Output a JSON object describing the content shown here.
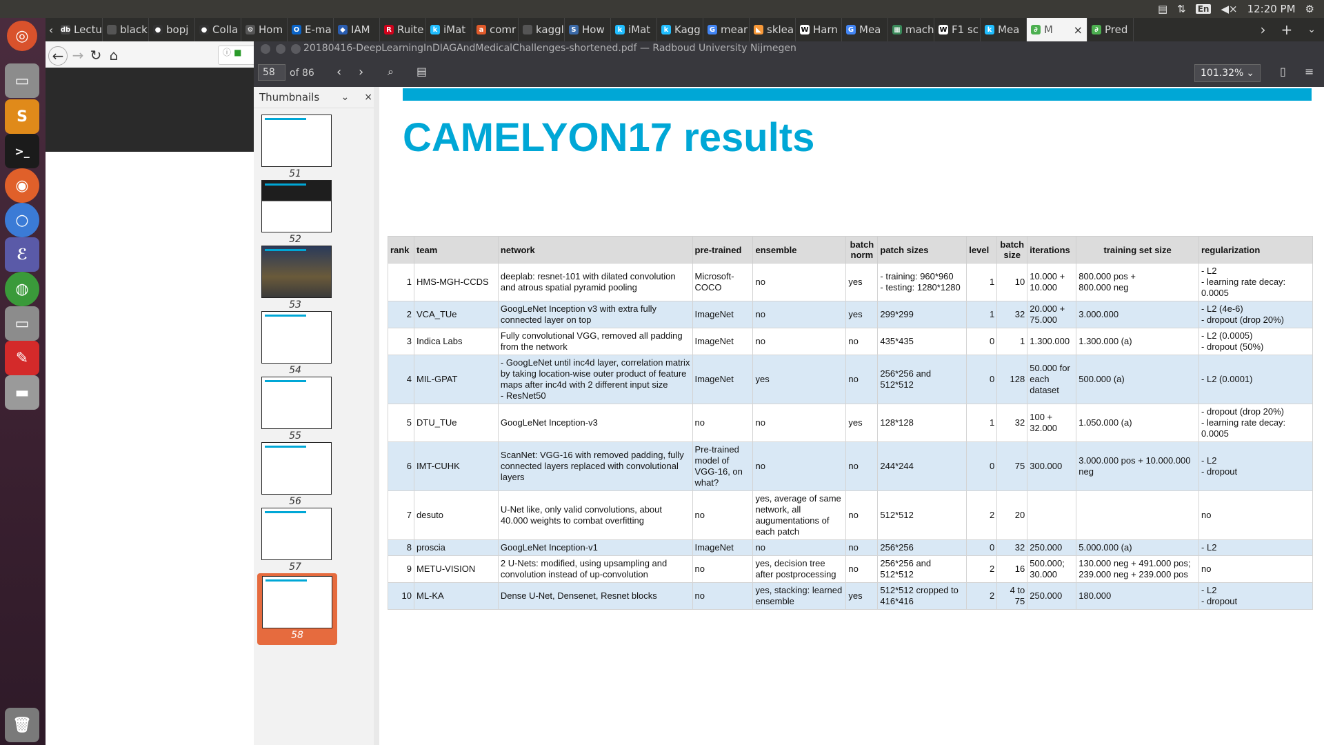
{
  "system": {
    "language": "En",
    "time": "12:20 PM"
  },
  "browser": {
    "tabs": [
      {
        "label": "Lectu",
        "icon": "dblp-icon",
        "color": "#444444",
        "glyph": "db"
      },
      {
        "label": "blackbo",
        "icon": "page-icon",
        "color": "#555555",
        "glyph": ""
      },
      {
        "label": "bopj",
        "icon": "github-icon",
        "color": "#333333",
        "glyph": "●"
      },
      {
        "label": "Colla",
        "icon": "github-icon",
        "color": "#333333",
        "glyph": "●"
      },
      {
        "label": "Hom",
        "icon": "gear-icon",
        "color": "#555555",
        "glyph": "⚙"
      },
      {
        "label": "E-ma",
        "icon": "outlook-icon",
        "color": "#0a64c8",
        "glyph": "O"
      },
      {
        "label": "IAM",
        "icon": "shield-icon",
        "color": "#2a5db0",
        "glyph": "◆"
      },
      {
        "label": "Ruite",
        "icon": "radboud-icon",
        "color": "#d0021b",
        "glyph": "R"
      },
      {
        "label": "iMat",
        "icon": "kaggle-icon",
        "color": "#20beff",
        "glyph": "k"
      },
      {
        "label": "comr",
        "icon": "ask-icon",
        "color": "#e05a2a",
        "glyph": "a"
      },
      {
        "label": "kaggle.c",
        "icon": "page-icon",
        "color": "#555555",
        "glyph": ""
      },
      {
        "label": "How",
        "icon": "stackexchange-icon",
        "color": "#3b6aa8",
        "glyph": "S"
      },
      {
        "label": "iMat",
        "icon": "kaggle-icon",
        "color": "#20beff",
        "glyph": "k"
      },
      {
        "label": "Kagg",
        "icon": "kaggle-icon",
        "color": "#20beff",
        "glyph": "k"
      },
      {
        "label": "mear",
        "icon": "google-icon",
        "color": "#4285f4",
        "glyph": "G"
      },
      {
        "label": "sklea",
        "icon": "sklearn-icon",
        "color": "#f89939",
        "glyph": "◣"
      },
      {
        "label": "Harn",
        "icon": "wikipedia-icon",
        "color": "#ffffff",
        "glyph": "W"
      },
      {
        "label": "Mea",
        "icon": "google-icon",
        "color": "#4285f4",
        "glyph": "G"
      },
      {
        "label": "mach",
        "icon": "chart-icon",
        "color": "#3a8a5a",
        "glyph": "▦"
      },
      {
        "label": "F1 sc",
        "icon": "wikipedia-icon",
        "color": "#ffffff",
        "glyph": "W"
      },
      {
        "label": "Mea",
        "icon": "kaggle-icon",
        "color": "#20beff",
        "glyph": "k"
      },
      {
        "label": "M",
        "icon": "pdf-viewer-icon",
        "color": "#4caf50",
        "glyph": "∂",
        "active": true
      },
      {
        "label": "Pred",
        "icon": "pdf-viewer-icon",
        "color": "#4caf50",
        "glyph": "∂"
      }
    ]
  },
  "pdf": {
    "window_title": "20180416-DeepLearningInDIAGAndMedicalChallenges-shortened.pdf — Radboud University Nijmegen",
    "page_number": "58",
    "page_count": "of 86",
    "zoom": "101.32%",
    "sidebar_title": "Thumbnails",
    "thumbnails": [
      "51",
      "52",
      "53",
      "54",
      "55",
      "56",
      "57",
      "58"
    ],
    "slide_title": "CAMELYON17 results"
  },
  "table": {
    "headers": [
      "rank",
      "team",
      "network",
      "pre-trained",
      "ensemble",
      "batch norm",
      "patch sizes",
      "level",
      "batch size",
      "iterations",
      "training set size",
      "regularization"
    ],
    "rows": [
      [
        "1",
        "HMS-MGH-CCDS",
        "deeplab: resnet-101 with dilated convolution and atrous spatial pyramid pooling",
        "Microsoft-COCO",
        "no",
        "yes",
        "- training: 960*960\n- testing: 1280*1280",
        "1",
        "10",
        "10.000 + 10.000",
        "800.000 pos +\n800.000 neg",
        "- L2\n- learning rate decay: 0.0005"
      ],
      [
        "2",
        "VCA_TUe",
        "GoogLeNet Inception v3 with extra fully connected layer on top",
        "ImageNet",
        "no",
        "yes",
        "299*299",
        "1",
        "32",
        "20.000 + 75.000",
        "3.000.000",
        "- L2 (4e-6)\n- dropout (drop 20%)"
      ],
      [
        "3",
        "Indica Labs",
        "Fully convolutional VGG, removed all padding from the network",
        "ImageNet",
        "no",
        "no",
        "435*435",
        "0",
        "1",
        "1.300.000",
        "1.300.000 (a)",
        "- L2 (0.0005)\n- dropout (50%)"
      ],
      [
        "4",
        "MIL-GPAT",
        "- GoogLeNet until inc4d layer, correlation matrix by taking location-wise outer product of feature maps after inc4d with 2 different input size\n- ResNet50",
        "ImageNet",
        "yes",
        "no",
        "256*256 and 512*512",
        "0",
        "128",
        "50.000 for each dataset",
        "500.000 (a)",
        "- L2 (0.0001)"
      ],
      [
        "5",
        "DTU_TUe",
        "GoogLeNet Inception-v3",
        "no",
        "no",
        "yes",
        "128*128",
        "1",
        "32",
        "100 + 32.000",
        "1.050.000 (a)",
        "- dropout (drop 20%)\n- learning rate decay: 0.0005"
      ],
      [
        "6",
        "IMT-CUHK",
        "ScanNet: VGG-16 with removed padding, fully connected layers replaced with convolutional layers",
        "Pre-trained model of VGG-16, on what?",
        "no",
        "no",
        "244*244",
        "0",
        "75",
        "300.000",
        "3.000.000 pos + 10.000.000 neg",
        "- L2\n- dropout"
      ],
      [
        "7",
        "desuto",
        "U-Net like, only valid convolutions, about 40.000 weights to combat overfitting",
        "no",
        "yes, average of same network, all augumentations of each patch",
        "no",
        "512*512",
        "2",
        "20",
        "",
        "",
        "no"
      ],
      [
        "8",
        "proscia",
        "GoogLeNet Inception-v1",
        "ImageNet",
        "no",
        "no",
        "256*256",
        "0",
        "32",
        "250.000",
        "5.000.000 (a)",
        "- L2"
      ],
      [
        "9",
        "METU-VISION",
        "2 U-Nets: modified, using upsampling and convolution instead of up-convolution",
        "no",
        "yes, decision tree after postprocessing",
        "no",
        "256*256 and 512*512",
        "2",
        "16",
        "500.000; 30.000",
        "130.000 neg + 491.000 pos; 239.000 neg + 239.000 pos",
        "no"
      ],
      [
        "10",
        "ML-KA",
        "Dense U-Net, Densenet, Resnet blocks",
        "no",
        "yes, stacking: learned ensemble",
        "yes",
        "512*512 cropped to 416*416",
        "2",
        "4 to 75",
        "250.000",
        "180.000",
        "- L2\n- dropout"
      ]
    ]
  },
  "colors": {
    "accent": "#00a7d6",
    "row_alt": "#d9e8f5",
    "selected_thumb": "#e66b3e"
  }
}
